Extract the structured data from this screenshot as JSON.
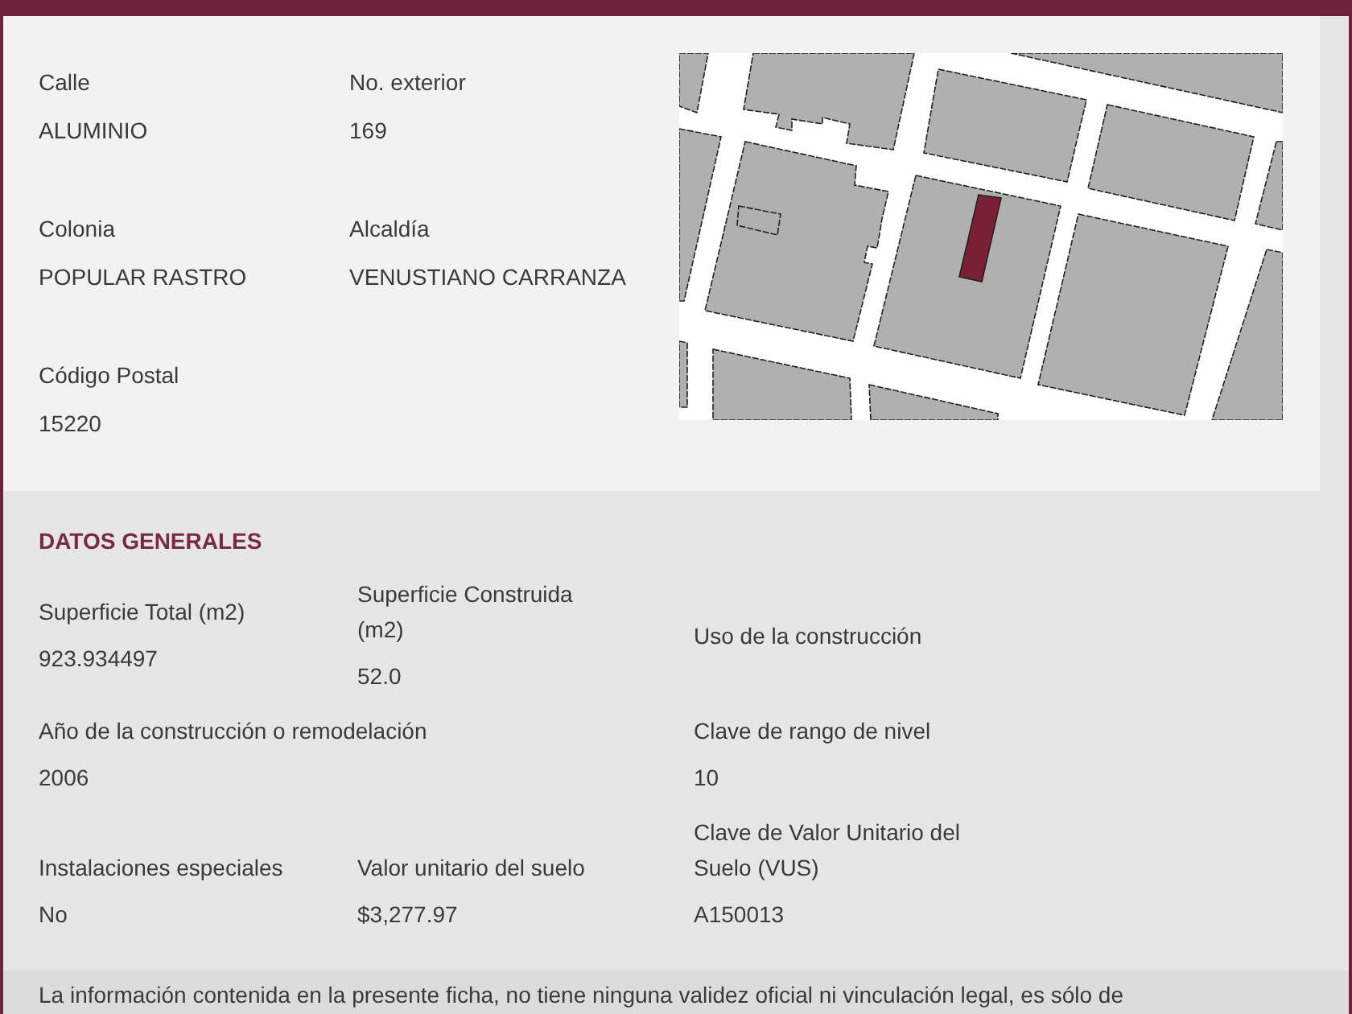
{
  "address": {
    "fields": [
      {
        "label": "Calle",
        "value": "ALUMINIO"
      },
      {
        "label": "No. exterior",
        "value": "169"
      },
      {
        "label": "Colonia",
        "value": "POPULAR RASTRO"
      },
      {
        "label": "Alcaldía",
        "value": "VENUSTIANO CARRANZA"
      },
      {
        "label": "Código Postal",
        "value": "15220"
      }
    ]
  },
  "general_data": {
    "title": "DATOS GENERALES",
    "rows": [
      [
        {
          "label": "Superficie Total (m2)",
          "value": "923.934497"
        },
        {
          "label": "Superficie Construida (m2)",
          "value": "52.0"
        },
        {
          "label": "Uso de la construcción"
        }
      ],
      [
        {
          "label": "Año de la construcción o remodelación",
          "value": "2006"
        },
        "",
        {
          "label": "Clave de rango de nivel",
          "value": "10"
        }
      ],
      [
        {
          "label": "Instalaciones especiales",
          "value": "No"
        },
        {
          "label": "Valor unitario del suelo",
          "value": "$3,277.97"
        },
        {
          "label": "Clave de Valor Unitario del Suelo (VUS)",
          "value": "A150013"
        }
      ]
    ]
  },
  "disclaimer": "La información contenida en la presente ficha, no tiene ninguna validez oficial ni vinculación legal, es sólo de"
}
